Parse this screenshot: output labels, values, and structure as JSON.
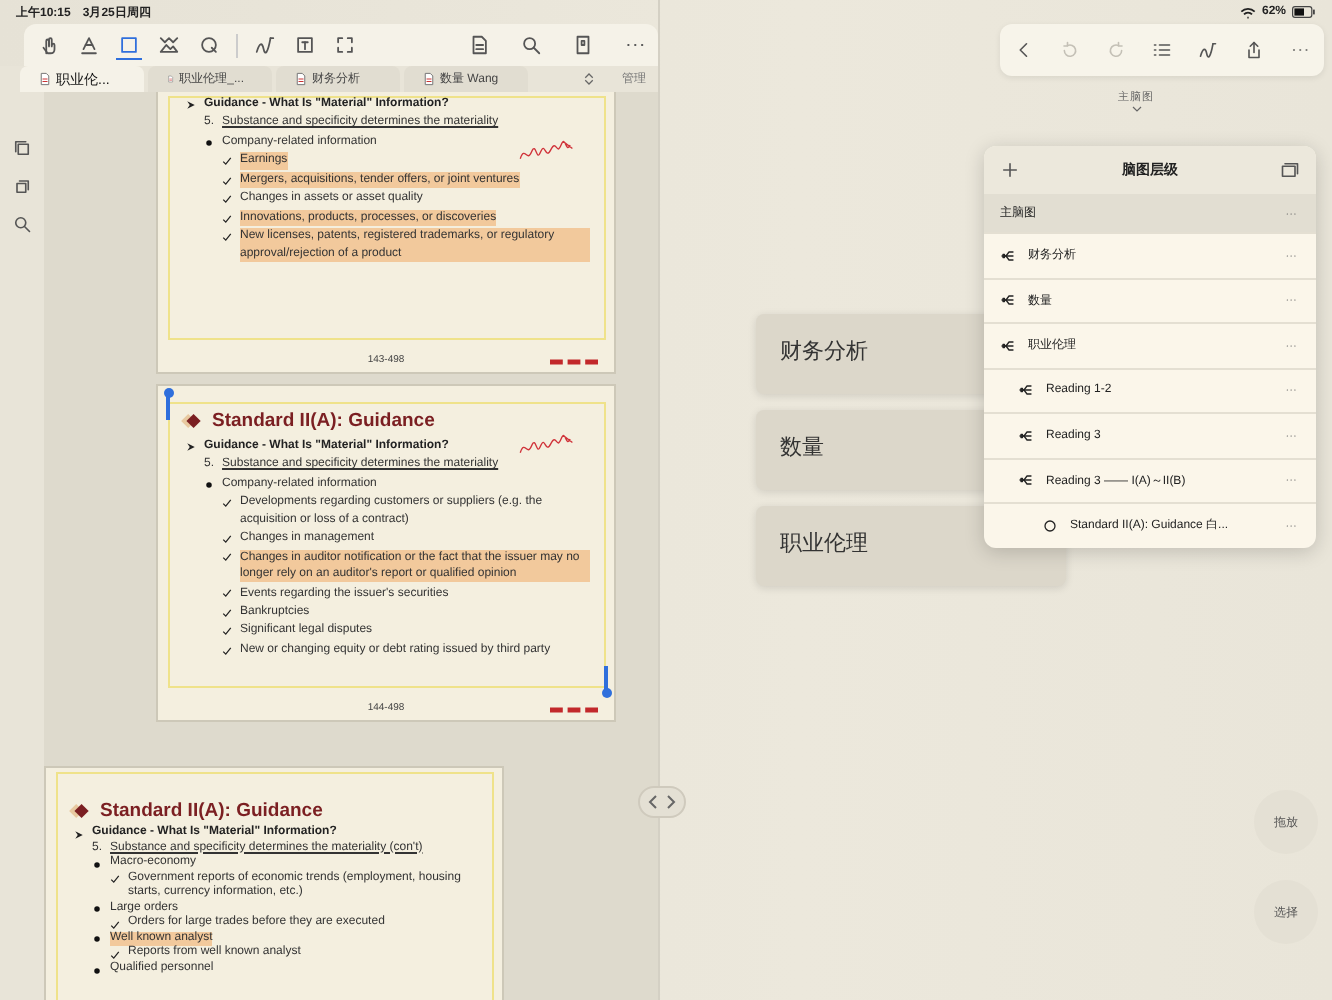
{
  "status_bar": {
    "time": "上午10:15",
    "date": "3月25日周四",
    "battery": "62%"
  },
  "pdf_toolbar": {
    "tools": [
      {
        "kind": "hand",
        "selected": false
      },
      {
        "kind": "marker",
        "selected": false
      },
      {
        "kind": "frame",
        "selected": true
      },
      {
        "kind": "image",
        "selected": false
      },
      {
        "kind": "lasso",
        "selected": false
      },
      {
        "kind": "curve",
        "selected": false
      },
      {
        "kind": "textbox",
        "selected": false
      },
      {
        "kind": "select",
        "selected": false
      }
    ],
    "actions": [
      {
        "kind": "document"
      },
      {
        "kind": "search"
      },
      {
        "kind": "bookmark"
      },
      {
        "kind": "more"
      }
    ]
  },
  "tabs": [
    {
      "label": "职业伦...",
      "selected": true
    },
    {
      "label": "职业伦理_...",
      "selected": false
    },
    {
      "label": "财务分析",
      "selected": false
    },
    {
      "label": "数量 Wang",
      "selected": false
    }
  ],
  "manage": "管理",
  "pages": [
    {
      "selected": false,
      "footer": "143-498",
      "items": [
        {
          "kind": "guidance",
          "text": "Guidance - What Is \"Material\" Information?",
          "highlighted": false
        },
        {
          "kind": "numbered",
          "number": "5.",
          "text": "Substance and specificity determines the materiality",
          "highlighted": false
        },
        {
          "kind": "bullet",
          "text": "Company-related information",
          "highlighted": false
        },
        {
          "kind": "check",
          "text": "Earnings",
          "highlighted": true
        },
        {
          "kind": "check",
          "text": "Mergers, acquisitions, tender offers, or joint ventures",
          "highlighted": true
        },
        {
          "kind": "check",
          "text": "Changes in assets or asset quality",
          "highlighted": false
        },
        {
          "kind": "check",
          "text": "Innovations, products, processes, or discoveries",
          "highlighted": true
        },
        {
          "kind": "check",
          "text": "New licenses, patents, registered trademarks, or regulatory approval/rejection of a product",
          "highlighted": true
        }
      ]
    },
    {
      "selected": true,
      "title": "Standard II(A): Guidance",
      "footer": "144-498",
      "items": [
        {
          "kind": "guidance",
          "text": "Guidance - What Is \"Material\" Information?",
          "highlighted": false
        },
        {
          "kind": "numbered",
          "number": "5.",
          "text": "Substance and specificity determines the materiality",
          "highlighted": false
        },
        {
          "kind": "bullet",
          "text": "Company-related information",
          "highlighted": false
        },
        {
          "kind": "check",
          "text": "Developments regarding customers or suppliers (e.g. the acquisition or loss of a contract)",
          "highlighted": false
        },
        {
          "kind": "check",
          "text": "Changes in management",
          "highlighted": false
        },
        {
          "kind": "check",
          "text": "Changes in auditor notification or the fact that the issuer may no longer rely on an auditor's report or qualified opinion",
          "highlighted": true
        },
        {
          "kind": "check",
          "text": "Events regarding the issuer's securities",
          "highlighted": false
        },
        {
          "kind": "check",
          "text": "Bankruptcies",
          "highlighted": false
        },
        {
          "kind": "check",
          "text": "Significant legal disputes",
          "highlighted": false
        },
        {
          "kind": "check",
          "text": "New or changing equity or debt rating issued by third party",
          "highlighted": false
        }
      ]
    },
    {
      "selected": false,
      "title": "Standard II(A): Guidance",
      "items": [
        {
          "kind": "guidance",
          "text": "Guidance - What Is \"Material\" Information?",
          "highlighted": false
        },
        {
          "kind": "numbered",
          "number": "5.",
          "text": "Substance and specificity determines the materiality (con't)",
          "highlighted": false
        },
        {
          "kind": "bullet",
          "text": "Macro-economy",
          "highlighted": false
        },
        {
          "kind": "check",
          "text": "Government reports of economic trends (employment, housing starts, currency information, etc.)",
          "highlighted": false
        },
        {
          "kind": "bullet",
          "text": "Large orders",
          "highlighted": false
        },
        {
          "kind": "check",
          "text": "Orders for large trades before they are executed",
          "highlighted": false
        },
        {
          "kind": "bullet",
          "text": "Well known analyst",
          "highlighted": true
        },
        {
          "kind": "check",
          "text": "Reports from well known analyst",
          "highlighted": false
        },
        {
          "kind": "bullet",
          "text": "Qualified personnel",
          "highlighted": false
        }
      ]
    }
  ],
  "map_toolbar": {
    "tools": [
      {
        "kind": "back",
        "disabled": false
      },
      {
        "kind": "undo",
        "disabled": true
      },
      {
        "kind": "redo",
        "disabled": true
      },
      {
        "kind": "list",
        "disabled": false
      },
      {
        "kind": "curve",
        "disabled": false
      },
      {
        "kind": "share",
        "disabled": false
      },
      {
        "kind": "more",
        "disabled": false
      }
    ]
  },
  "mindmap": {
    "label": "主脑图",
    "nodes": [
      {
        "label": "财务分析"
      },
      {
        "label": "数量"
      },
      {
        "label": "职业伦理"
      }
    ]
  },
  "mindmap_panel": {
    "title": "脑图层级",
    "root": {
      "label": "主脑图",
      "selected": true
    },
    "items": [
      {
        "kind": "map",
        "label": "财务分析",
        "selected": false
      },
      {
        "kind": "map",
        "label": "数量",
        "selected": false
      },
      {
        "kind": "map",
        "label": "职业伦理",
        "selected": false,
        "children": [
          {
            "kind": "map",
            "label": "Reading 1-2",
            "selected": false
          },
          {
            "kind": "map",
            "label": "Reading 3",
            "selected": false
          },
          {
            "kind": "map",
            "label": "Reading 3 —— I(A)～II(B)",
            "selected": false,
            "children": [
              {
                "kind": "node",
                "label": "Standard II(A): Guidance 白...",
                "selected": false
              }
            ]
          }
        ]
      }
    ]
  },
  "side_buttons": [
    "拖放",
    "选择"
  ]
}
